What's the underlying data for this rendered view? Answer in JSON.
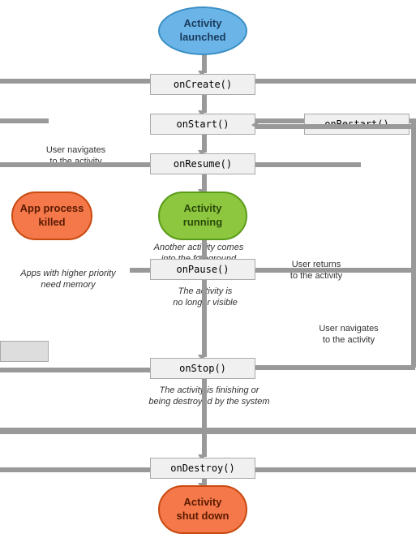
{
  "nodes": {
    "activity_launched": "Activity\nlaunched",
    "activity_running": "Activity\nrunning",
    "app_process_killed": "App process\nkilled",
    "activity_shutdown": "Activity\nshut down"
  },
  "methods": {
    "onCreate": "onCreate()",
    "onStart": "onStart()",
    "onRestart": "onRestart()",
    "onResume": "onResume()",
    "onPause": "onPause()",
    "onStop": "onStop()",
    "onDestroy": "onDestroy()"
  },
  "labels": {
    "user_navigates": "User navigates\nto the activity",
    "user_returns": "User returns\nto the activity",
    "another_activity": "Another activity comes\ninto the foreground",
    "apps_higher_priority": "Apps with higher priority\nneed memory",
    "activity_no_longer": "The activity is\nno longer visible",
    "user_navigates2": "User navigates\nto the activity",
    "finishing": "The activity is finishing or\nbeing destroyed by the system"
  }
}
